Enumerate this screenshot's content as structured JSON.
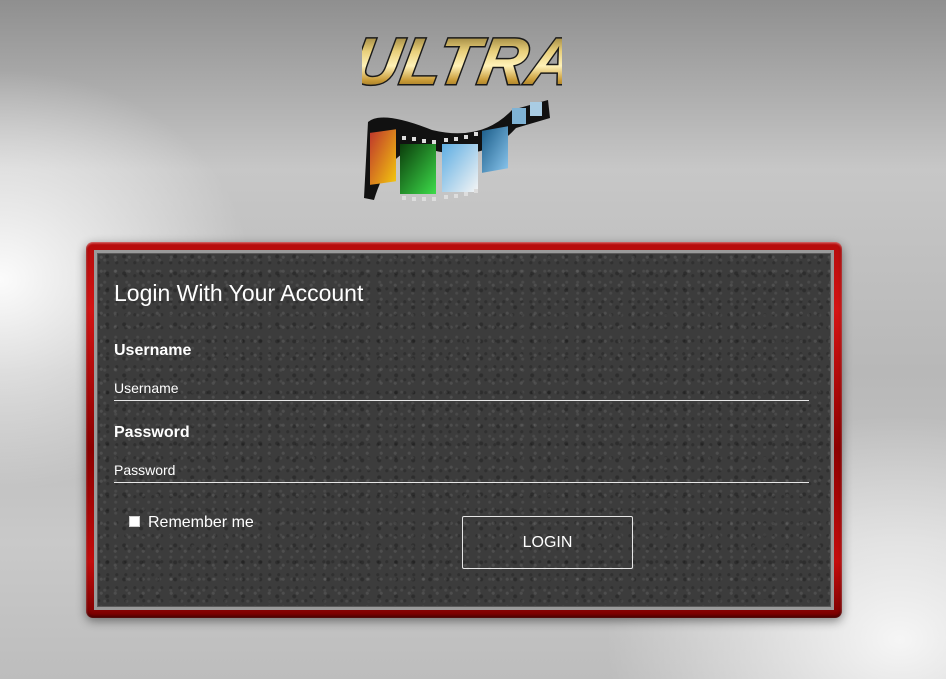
{
  "logo": {
    "text": "ULTRA",
    "icon": "film-reel-logo"
  },
  "login": {
    "title": "Login With Your Account",
    "username_label": "Username",
    "username_placeholder": "Username",
    "username_value": "",
    "password_label": "Password",
    "password_placeholder": "Password",
    "password_value": "",
    "remember_label": "Remember me",
    "remember_checked": false,
    "button_label": "LOGIN"
  },
  "colors": {
    "frame_red": "#c40d0d",
    "panel_dark": "#3c3c3c",
    "logo_gold": "#d9b24a"
  }
}
